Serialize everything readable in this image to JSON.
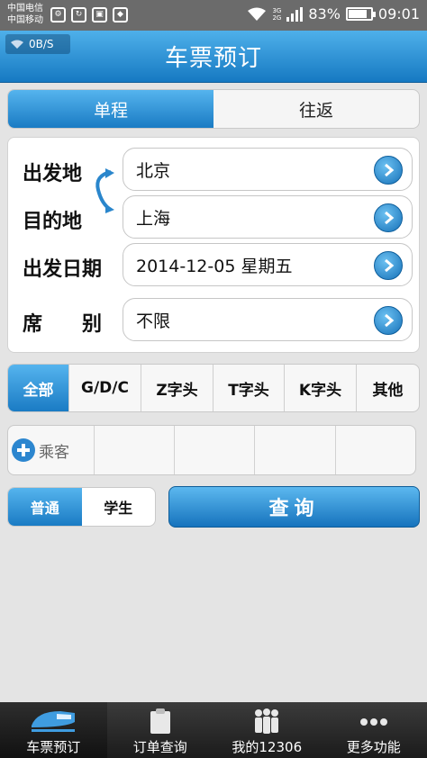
{
  "status_bar": {
    "carrier_1": "中国电信",
    "carrier_2": "中国移动",
    "net_1": "3G",
    "net_2": "2G",
    "battery_level": 0.83,
    "battery_text": "83%",
    "time": "09:01"
  },
  "header": {
    "speed": "0B/S",
    "title": "车票预订"
  },
  "trip_type": {
    "options": [
      "单程",
      "往返"
    ],
    "selected": "单程"
  },
  "form": {
    "from_label": "出发地",
    "from_value": "北京",
    "to_label": "目的地",
    "to_value": "上海",
    "date_label": "出发日期",
    "date_value": "2014-12-05 星期五",
    "seat_label": "席　　别",
    "seat_value": "不限"
  },
  "train_types": {
    "options": [
      "全部",
      "G/D/C",
      "Z字头",
      "T字头",
      "K字头",
      "其他"
    ],
    "selected": "全部"
  },
  "passenger": {
    "add_label": "乘客"
  },
  "ticket_type": {
    "options": [
      "普通",
      "学生"
    ],
    "selected": "普通"
  },
  "query_label": "查询",
  "bottom_nav": {
    "items": [
      "车票预订",
      "订单查询",
      "我的12306",
      "更多功能"
    ],
    "selected": "车票预订"
  },
  "colors": {
    "accent": "#1a7bc4",
    "header_top": "#4fb0ea",
    "nav_bg": "#1b1b1b"
  }
}
